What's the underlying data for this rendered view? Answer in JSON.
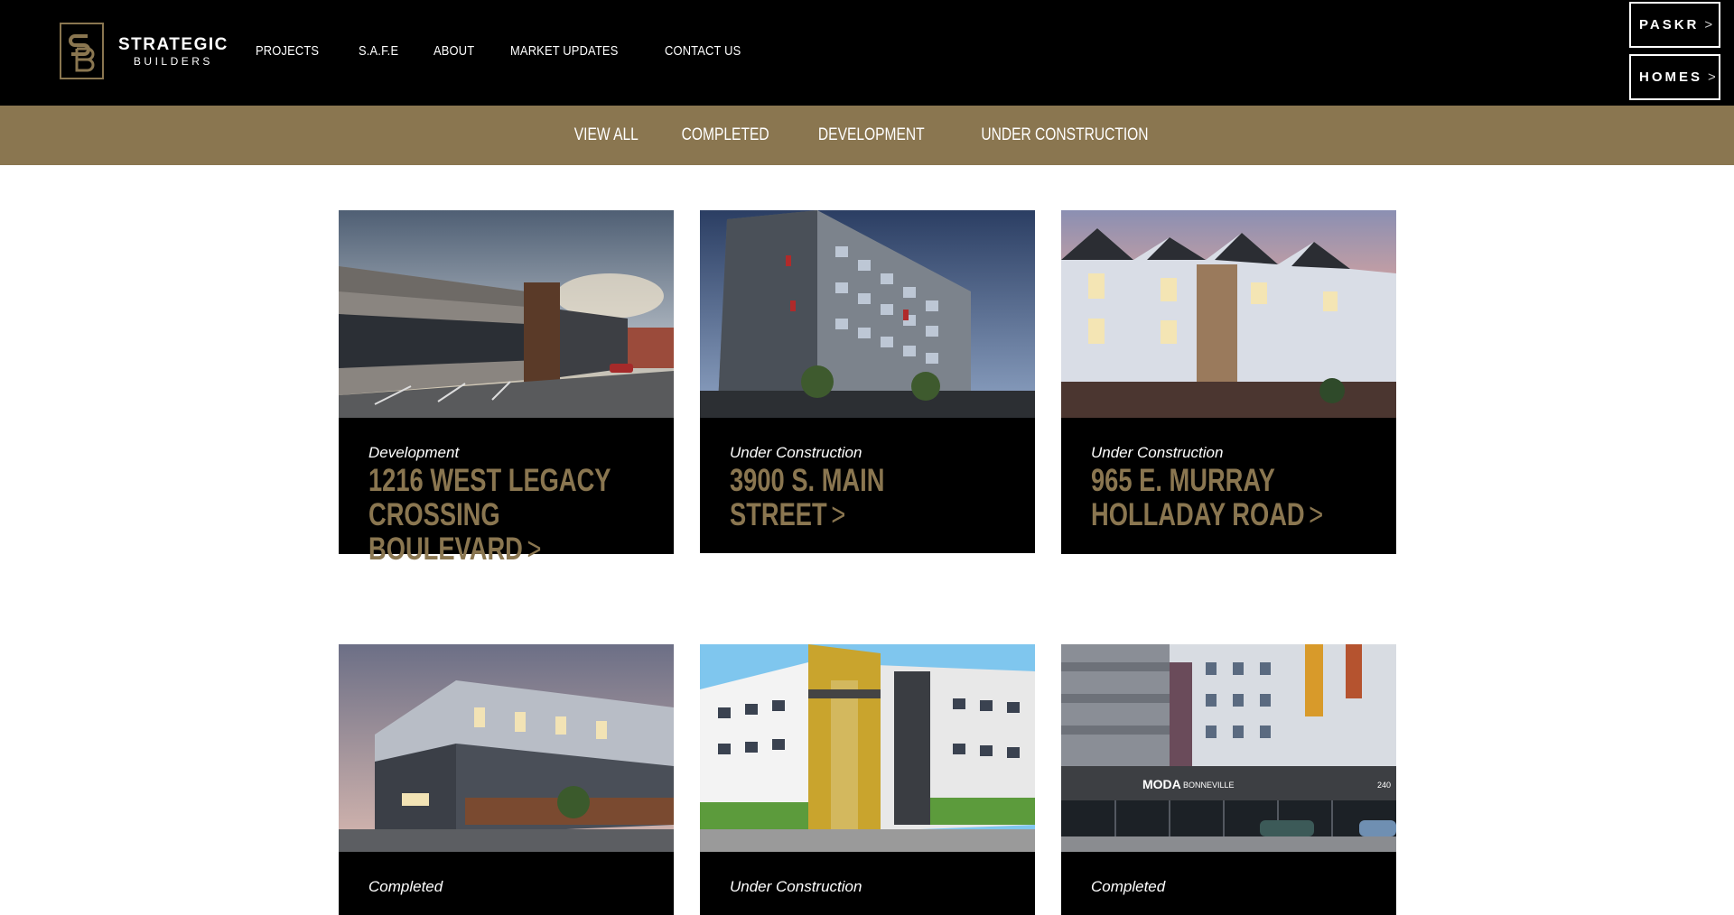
{
  "brand": {
    "line1": "STRATEGIC",
    "line2": "BUILDERS"
  },
  "nav": [
    {
      "label": "PROJECTS"
    },
    {
      "label": "S.A.F.E"
    },
    {
      "label": "ABOUT"
    },
    {
      "label": "MARKET UPDATES"
    },
    {
      "label": "CONTACT US"
    }
  ],
  "side_buttons": {
    "paskr": "PASKR",
    "homes": "HOMES",
    "chevron": ">"
  },
  "filters": [
    {
      "label": "VIEW ALL"
    },
    {
      "label": "COMPLETED"
    },
    {
      "label": "DEVELOPMENT"
    },
    {
      "label": "UNDER CONSTRUCTION"
    }
  ],
  "projects": [
    {
      "status": "Development",
      "title": "1216 WEST LEGACY CROSSING BOULEVARD",
      "chevron": ">"
    },
    {
      "status": "Under Construction",
      "title": "3900 S. MAIN STREET",
      "chevron": ">"
    },
    {
      "status": "Under Construction",
      "title": "965 E. MURRAY HOLLADAY ROAD",
      "chevron": ">"
    },
    {
      "status": "Completed",
      "title": "",
      "chevron": ""
    },
    {
      "status": "Under Construction",
      "title": "",
      "chevron": ""
    },
    {
      "status": "Completed",
      "title": "",
      "chevron": ""
    }
  ],
  "signage": {
    "moda": "MODA",
    "bonneville": "BONNEVILLE",
    "number": "240"
  },
  "colors": {
    "gold": "#8a7650",
    "black": "#000000",
    "white": "#ffffff"
  }
}
